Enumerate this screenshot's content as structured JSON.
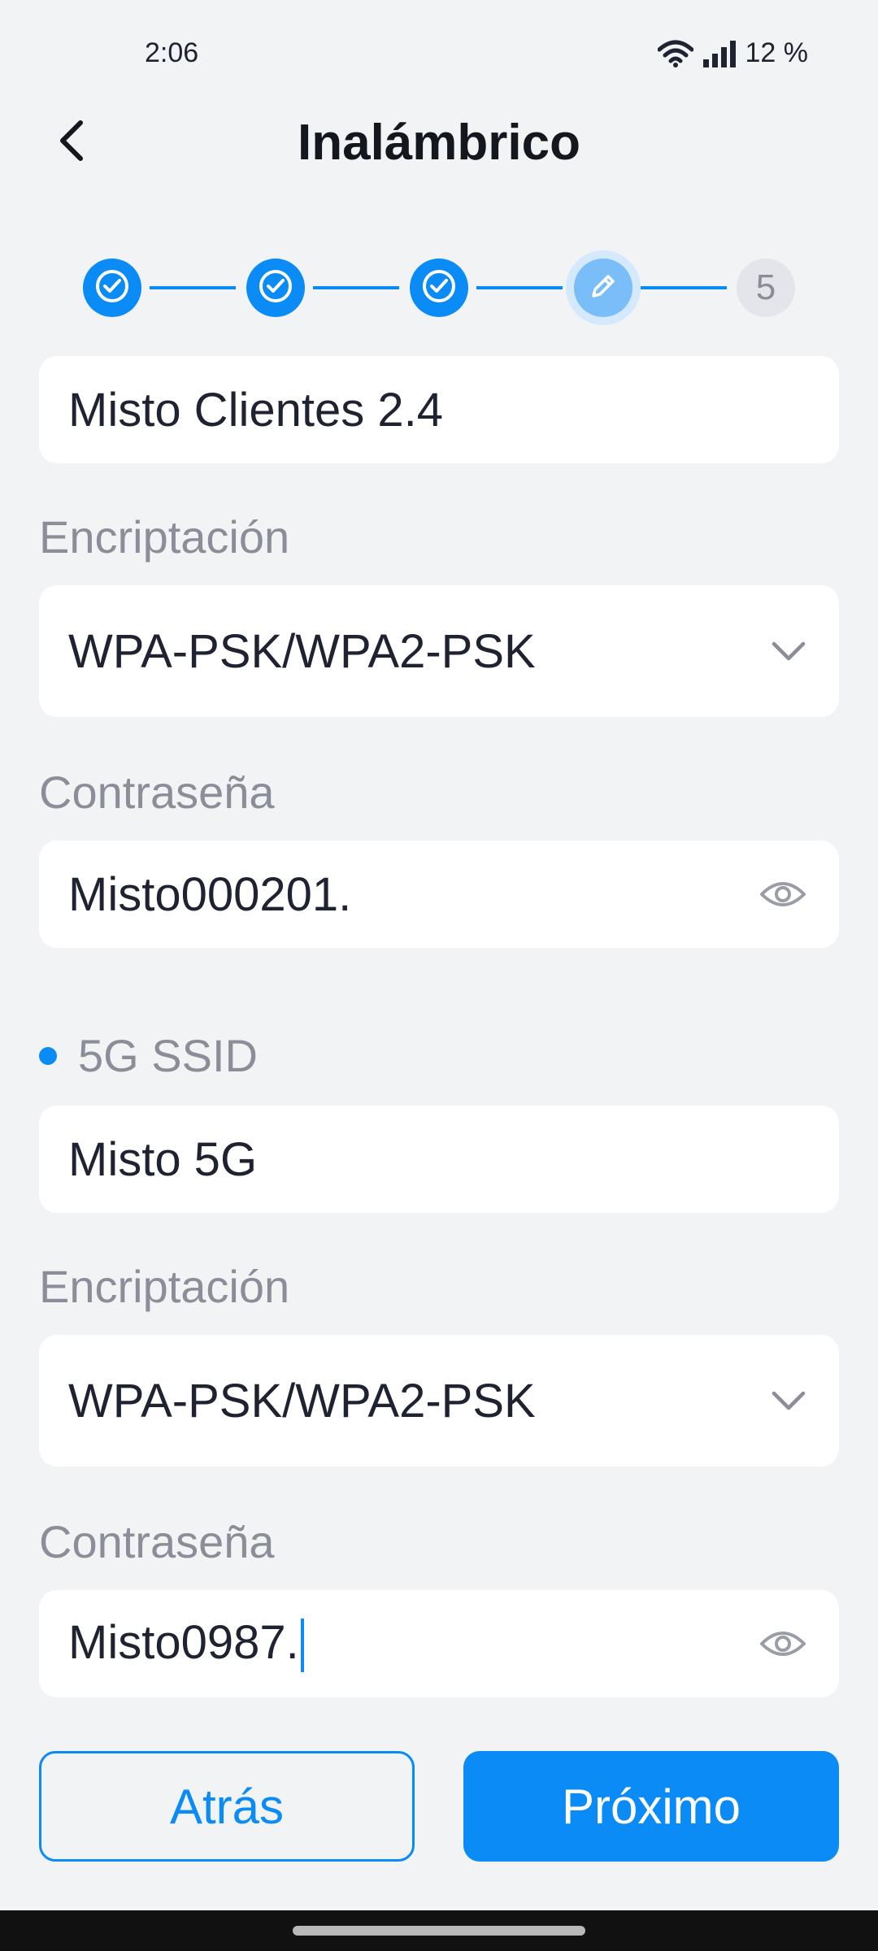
{
  "status_bar": {
    "time": "2:06",
    "battery": "12 %",
    "icons": [
      "wifi-icon",
      "signal-icon"
    ]
  },
  "header": {
    "title": "Inalámbrico",
    "back_icon": "chevron-left-icon"
  },
  "stepper": {
    "steps": [
      {
        "state": "done",
        "icon": "check-circle-icon"
      },
      {
        "state": "done",
        "icon": "check-circle-icon"
      },
      {
        "state": "done",
        "icon": "check-circle-icon"
      },
      {
        "state": "active",
        "icon": "pencil-icon"
      },
      {
        "state": "todo",
        "label": "5"
      }
    ]
  },
  "band_24": {
    "ssid_value": "Misto Clientes 2.4",
    "encryption_label": "Encriptación",
    "encryption_value": "WPA-PSK/WPA2-PSK",
    "password_label": "Contraseña",
    "password_value": "Misto000201."
  },
  "band_5": {
    "section_label": "5G SSID",
    "ssid_value": "Misto 5G",
    "encryption_label": "Encriptación",
    "encryption_value": "WPA-PSK/WPA2-PSK",
    "password_label": "Contraseña",
    "password_value": "Misto0987."
  },
  "actions": {
    "back_label": "Atrás",
    "next_label": "Próximo"
  },
  "colors": {
    "accent": "#0a8bf5",
    "background": "#f2f3f5",
    "card": "#ffffff",
    "label": "#8b8e98"
  }
}
